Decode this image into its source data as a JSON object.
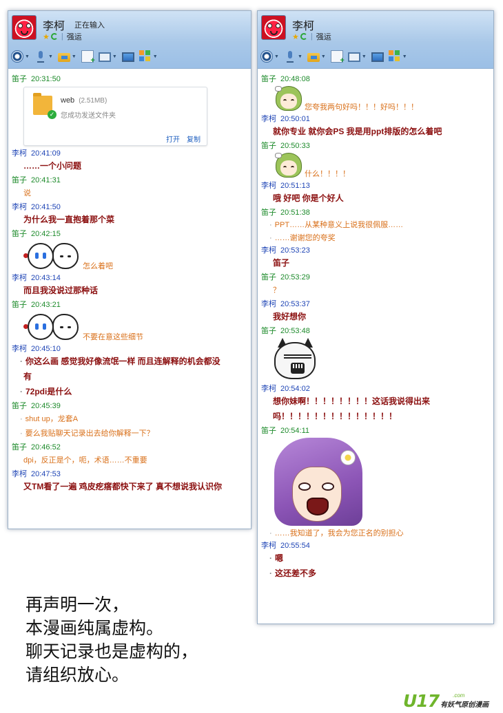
{
  "window": {
    "contact_name": "李柯",
    "typing_status": "正在输入",
    "signature": "强运"
  },
  "file_card": {
    "filename": "web",
    "size": "(2.51MB)",
    "status": "您成功发送文件夹",
    "open_label": "打开",
    "copy_label": "复制"
  },
  "left_chat": [
    {
      "sender": "笛子",
      "time": "20:31:50"
    },
    {
      "sender": "李柯",
      "time": "20:41:09",
      "text": "……一个小问题"
    },
    {
      "sender": "笛子",
      "time": "20:41:31",
      "text": "说"
    },
    {
      "sender": "李柯",
      "time": "20:41:50",
      "text": "为什么我一直抱着那个菜"
    },
    {
      "sender": "笛子",
      "time": "20:42:15",
      "caption": "怎么着吧"
    },
    {
      "sender": "李柯",
      "time": "20:43:14",
      "text": "而且我没说过那种话"
    },
    {
      "sender": "笛子",
      "time": "20:43:21",
      "caption": "不要在意这些细节"
    },
    {
      "sender": "李柯",
      "time": "20:45:10",
      "lines": [
        "你这么画 感觉我好像流氓一样 而且连解释的机会都没",
        "有",
        "72pdi是什么"
      ]
    },
    {
      "sender": "笛子",
      "time": "20:45:39",
      "lines": [
        "shut up，龙套A",
        "要么我贴聊天记录出去给你解释一下？"
      ]
    },
    {
      "sender": "笛子",
      "time": "20:46:52",
      "text": "dpi，反正是个，呃，术语……不重要"
    },
    {
      "sender": "李柯",
      "time": "20:47:53",
      "text": "又TM看了一遍 鸡皮疙瘩都快下来了 真不想说我认识你"
    }
  ],
  "right_chat": [
    {
      "sender": "笛子",
      "time": "20:48:08",
      "caption": "您夸我两句好吗！！！好吗！！！"
    },
    {
      "sender": "李柯",
      "time": "20:50:01",
      "text": "就你专业 就你会PS 我是用ppt排版的怎么着吧"
    },
    {
      "sender": "笛子",
      "time": "20:50:33",
      "caption": "什么！！！！"
    },
    {
      "sender": "李柯",
      "time": "20:51:13",
      "text": "哦 好吧 你是个好人"
    },
    {
      "sender": "笛子",
      "time": "20:51:38",
      "lines": [
        "PPT……从某种意义上说我很佩服……",
        "……谢谢您的夸奖"
      ]
    },
    {
      "sender": "李柯",
      "time": "20:53:23",
      "text": "笛子"
    },
    {
      "sender": "笛子",
      "time": "20:53:29",
      "text": "？"
    },
    {
      "sender": "李柯",
      "time": "20:53:37",
      "text": "我好想你"
    },
    {
      "sender": "笛子",
      "time": "20:53:48"
    },
    {
      "sender": "李柯",
      "time": "20:54:02",
      "lines": [
        "想你妹啊！！！！！！！！这话我说得出来",
        "吗！！！！！！！！！！！！！！"
      ]
    },
    {
      "sender": "笛子",
      "time": "20:54:11",
      "text": "……我知道了，我会为您正名的别担心"
    },
    {
      "sender": "李柯",
      "time": "20:55:54",
      "lines": [
        "嗯",
        "这还差不多"
      ]
    }
  ],
  "statement": [
    "再声明一次，",
    "本漫画纯属虚构。",
    "聊天记录也是虚构的，",
    "请组织放心。"
  ],
  "logo": {
    "main": "U17",
    "domain": ".com",
    "slogan": "有妖气原创漫画"
  },
  "icons": [
    "avatar",
    "star-icon",
    "swirl-icon",
    "camera-icon",
    "mic-icon",
    "folder-send-icon",
    "add-doc-icon",
    "screen-share-icon",
    "remote-screen-icon",
    "apps-icon"
  ],
  "colors": {
    "sender_green": "#1c8a2a",
    "sender_blue": "#1e44b5",
    "his_text": "#8b0f0f",
    "her_text": "#d9701a",
    "titlebar": "#a9c8e8"
  }
}
